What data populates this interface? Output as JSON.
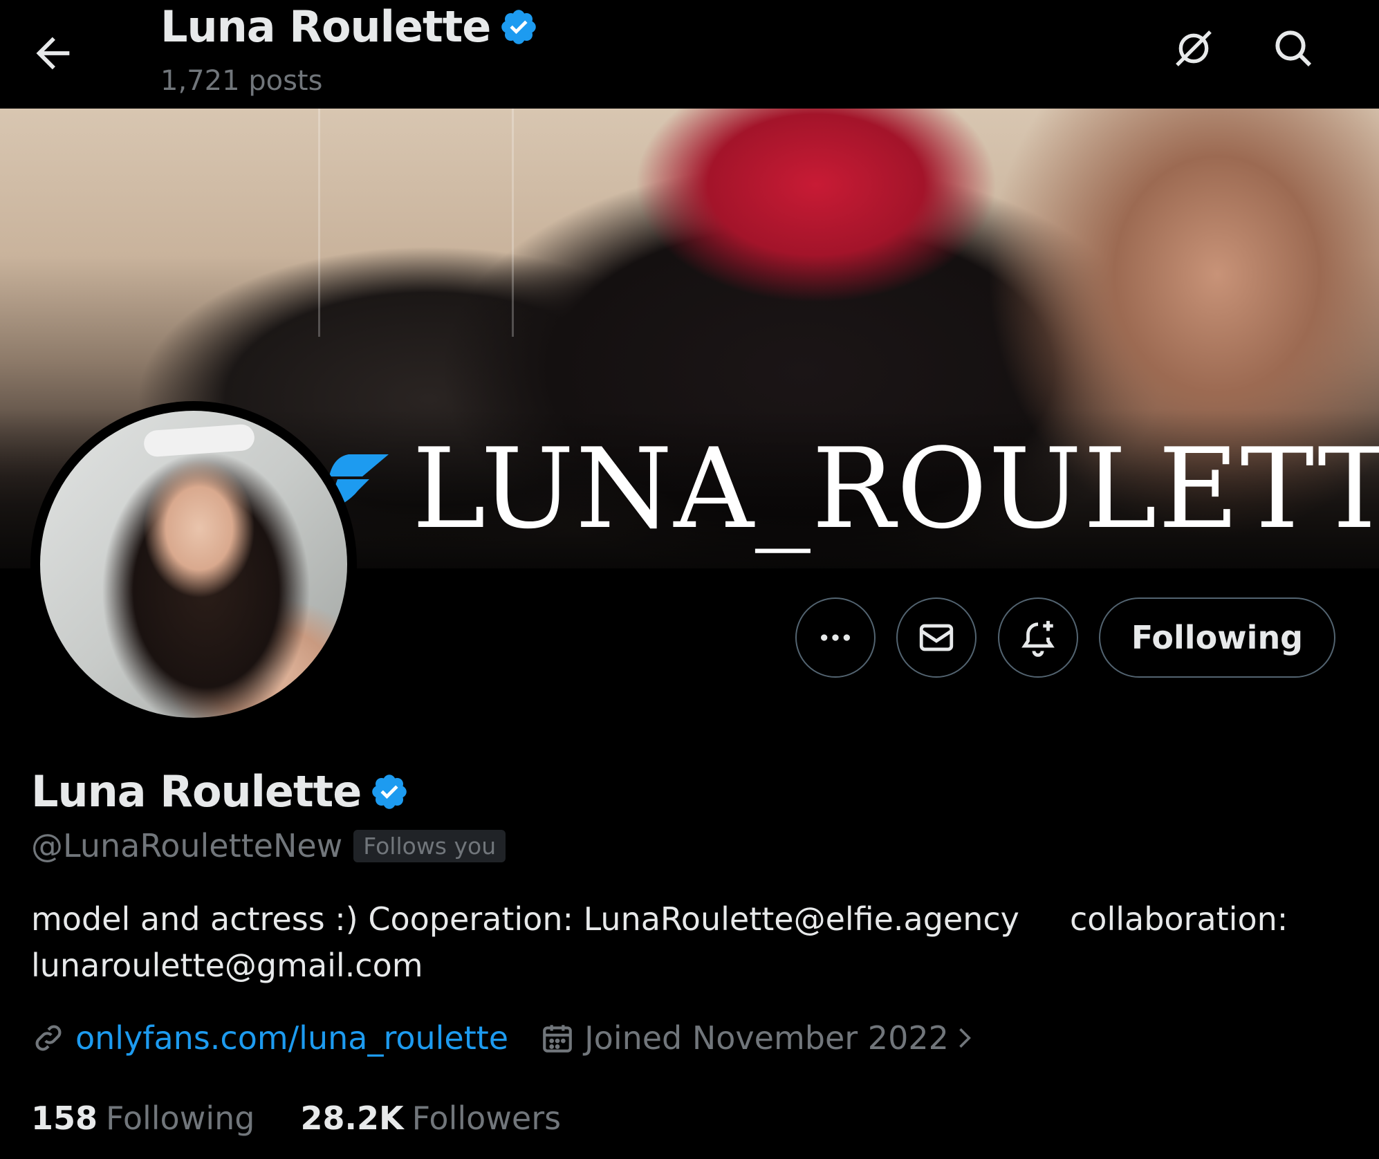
{
  "header": {
    "display_name": "Luna Roulette",
    "posts_count": "1,721 posts"
  },
  "banner": {
    "text": "LUNA_ROULETTE"
  },
  "actions": {
    "following_label": "Following"
  },
  "profile": {
    "display_name": "Luna Roulette",
    "handle": "@LunaRouletteNew",
    "follows_you": "Follows you",
    "bio_line1": "model and actress :) Cooperation: LunaRoulette@elfie.agency     collaboration:",
    "bio_line2": "lunaroulette@gmail.com",
    "website": "onlyfans.com/luna_roulette",
    "joined": "Joined November 2022"
  },
  "stats": {
    "following_count": "158",
    "following_label": "Following",
    "followers_count": "28.2K",
    "followers_label": "Followers"
  },
  "colors": {
    "background": "#000000",
    "text_primary": "#e7e9ea",
    "text_secondary": "#71767b",
    "accent": "#1d9bf0",
    "border": "#536471"
  },
  "icons": [
    "back-arrow-icon",
    "verified-badge-icon",
    "grok-icon",
    "search-icon",
    "more-icon",
    "mail-icon",
    "bell-plus-icon",
    "link-icon",
    "calendar-icon",
    "chevron-right-icon"
  ]
}
